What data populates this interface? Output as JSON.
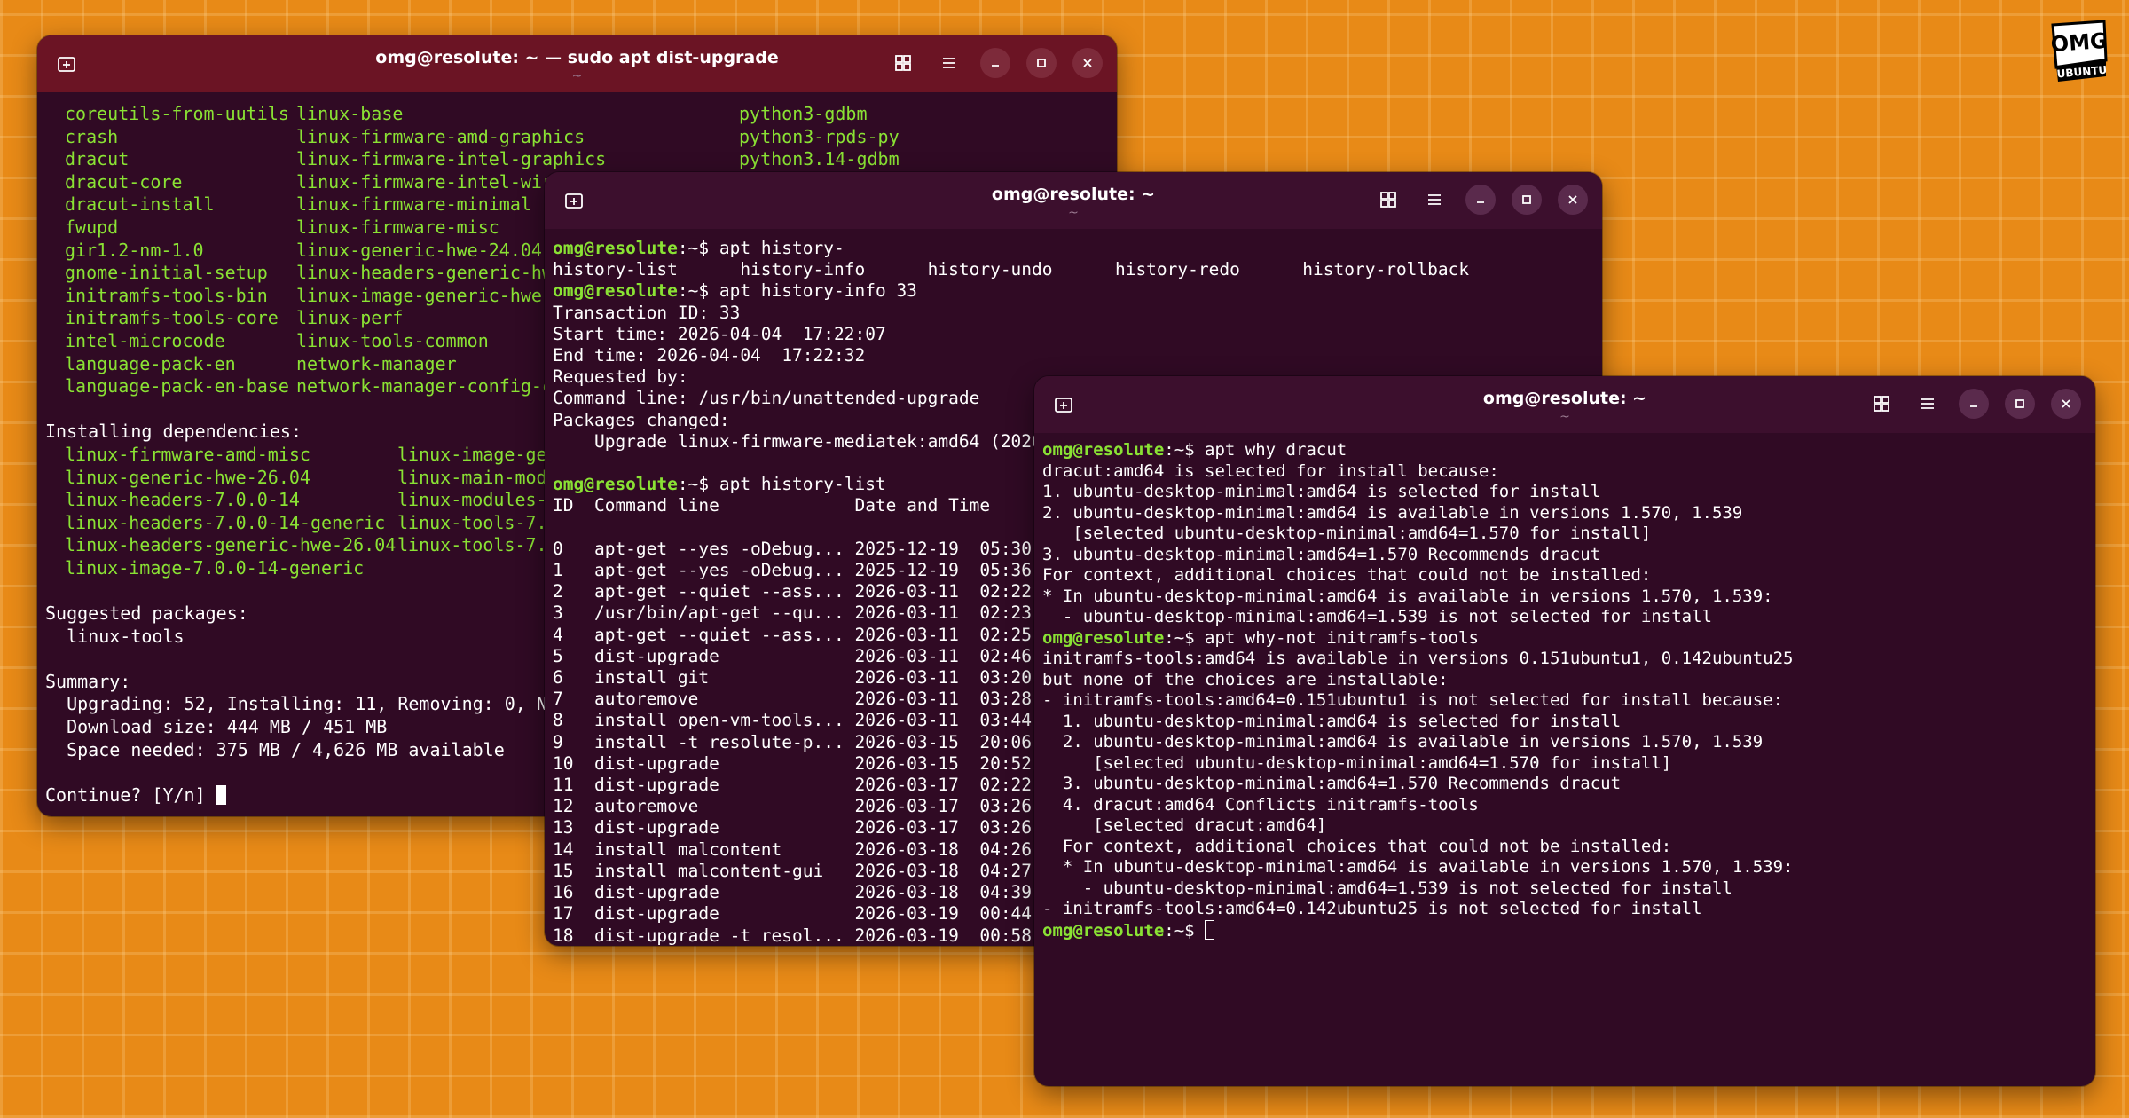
{
  "logo": {
    "line1": "OMG",
    "line2": "UBUNTU"
  },
  "win1": {
    "title": "omg@resolute: ~ — sudo apt dist-upgrade",
    "subtitle": "~",
    "col1": [
      "coreutils-from-uutils",
      "crash",
      "dracut",
      "dracut-core",
      "dracut-install",
      "fwupd",
      "gir1.2-nm-1.0",
      "gnome-initial-setup",
      "initramfs-tools-bin",
      "initramfs-tools-core",
      "intel-microcode",
      "language-pack-en",
      "language-pack-en-base"
    ],
    "col2": [
      "linux-base",
      "linux-firmware-amd-graphics",
      "linux-firmware-intel-graphics",
      "linux-firmware-intel-wireless",
      "linux-firmware-minimal",
      "linux-firmware-misc",
      "linux-generic-hwe-24.04",
      "linux-headers-generic-hwe-24.04",
      "linux-image-generic-hwe-24.04",
      "linux-perf",
      "linux-tools-common",
      "network-manager",
      "network-manager-config-connectivity-ubuntu"
    ],
    "col3": [
      "python3-gdbm",
      "python3-rpds-py",
      "python3.14-gdbm"
    ],
    "installing_deps_heading": "Installing dependencies:",
    "deps_col1": [
      "linux-firmware-amd-misc",
      "linux-generic-hwe-26.04",
      "linux-headers-7.0.0-14",
      "linux-headers-7.0.0-14-generic",
      "linux-headers-generic-hwe-26.04",
      "linux-image-7.0.0-14-generic"
    ],
    "deps_col2": [
      "linux-image-generic",
      "linux-main-modules",
      "linux-modules-7.0.0",
      "linux-tools-7.0.0",
      "linux-tools-7.0.0",
      ""
    ],
    "suggested_heading": "Suggested packages:",
    "suggested_item": "  linux-tools",
    "summary_heading": "Summary:",
    "summary_lines": [
      "  Upgrading: 52, Installing: 11, Removing: 0, Not upgrading: 0",
      "  Download size: 444 MB / 451 MB",
      "  Space needed: 375 MB / 4,626 MB available"
    ],
    "continue_prompt": "Continue? [Y/n] "
  },
  "win2": {
    "title": "omg@resolute: ~",
    "subtitle": "~",
    "prompt": "omg@resolute",
    "prompt_suffix": ":~$ ",
    "cmd1": "apt history-",
    "completions": "history-list      history-info      history-undo      history-redo      history-rollback",
    "cmd2": "apt history-info 33",
    "info_lines": [
      "Transaction ID: 33",
      "Start time: 2026-04-04  17:22:07",
      "End time: 2026-04-04  17:22:32",
      "Requested by:",
      "Command line: /usr/bin/unattended-upgrade",
      "Packages changed:",
      "    Upgrade linux-firmware-mediatek:amd64 (20260227.git6b98a37c-0ubuntu1)"
    ],
    "cmd3": "apt history-list",
    "list_header": "ID  Command line             Date and Time",
    "rows": [
      [
        "0",
        "apt-get --yes -oDebug...",
        "2025-12-19",
        "05:30:00"
      ],
      [
        "1",
        "apt-get --yes -oDebug...",
        "2025-12-19",
        "05:36:47"
      ],
      [
        "2",
        "apt-get --quiet --ass...",
        "2026-03-11",
        "02:22:01"
      ],
      [
        "3",
        "/usr/bin/apt-get --qu...",
        "2026-03-11",
        "02:23:34"
      ],
      [
        "4",
        "apt-get --quiet --ass...",
        "2026-03-11",
        "02:25:11"
      ],
      [
        "5",
        "dist-upgrade",
        "2026-03-11",
        "02:46:28"
      ],
      [
        "6",
        "install git",
        "2026-03-11",
        "03:20:38"
      ],
      [
        "7",
        "autoremove",
        "2026-03-11",
        "03:28:15"
      ],
      [
        "8",
        "install open-vm-tools...",
        "2026-03-11",
        "03:44:49"
      ],
      [
        "9",
        "install -t resolute-p...",
        "2026-03-15",
        "20:06:44"
      ],
      [
        "10",
        "dist-upgrade",
        "2026-03-15",
        "20:52:50"
      ],
      [
        "11",
        "dist-upgrade",
        "2026-03-17",
        "02:22:09"
      ],
      [
        "12",
        "autoremove",
        "2026-03-17",
        "03:26:34"
      ],
      [
        "13",
        "dist-upgrade",
        "2026-03-17",
        "03:26:54"
      ],
      [
        "14",
        "install malcontent",
        "2026-03-18",
        "04:26:07"
      ],
      [
        "15",
        "install malcontent-gui",
        "2026-03-18",
        "04:27:39"
      ],
      [
        "16",
        "dist-upgrade",
        "2026-03-18",
        "04:39:55"
      ],
      [
        "17",
        "dist-upgrade",
        "2026-03-19",
        "00:44:01"
      ],
      [
        "18",
        "dist-upgrade -t resol...",
        "2026-03-19",
        "00:58:47"
      ]
    ]
  },
  "win3": {
    "title": "omg@resolute: ~",
    "subtitle": "~",
    "prompt": "omg@resolute",
    "prompt_suffix": ":~$ ",
    "cmd1": "apt why dracut",
    "why_lines": [
      "dracut:amd64 is selected for install because:",
      "1. ubuntu-desktop-minimal:amd64 is selected for install",
      "2. ubuntu-desktop-minimal:amd64 is available in versions 1.570, 1.539",
      "   [selected ubuntu-desktop-minimal:amd64=1.570 for install]",
      "3. ubuntu-desktop-minimal:amd64=1.570 Recommends dracut",
      "For context, additional choices that could not be installed:",
      "* In ubuntu-desktop-minimal:amd64 is available in versions 1.570, 1.539:",
      "  - ubuntu-desktop-minimal:amd64=1.539 is not selected for install"
    ],
    "cmd2": "apt why-not initramfs-tools",
    "whynot_lines": [
      "initramfs-tools:amd64 is available in versions 0.151ubuntu1, 0.142ubuntu25",
      "but none of the choices are installable:",
      "- initramfs-tools:amd64=0.151ubuntu1 is not selected for install because:",
      "  1. ubuntu-desktop-minimal:amd64 is selected for install",
      "  2. ubuntu-desktop-minimal:amd64 is available in versions 1.570, 1.539",
      "     [selected ubuntu-desktop-minimal:amd64=1.570 for install]",
      "  3. ubuntu-desktop-minimal:amd64=1.570 Recommends dracut",
      "  4. dracut:amd64 Conflicts initramfs-tools",
      "     [selected dracut:amd64]",
      "  For context, additional choices that could not be installed:",
      "  * In ubuntu-desktop-minimal:amd64 is available in versions 1.570, 1.539:",
      "    - ubuntu-desktop-minimal:amd64=1.539 is not selected for install",
      "- initramfs-tools:amd64=0.142ubuntu25 is not selected for install"
    ]
  }
}
